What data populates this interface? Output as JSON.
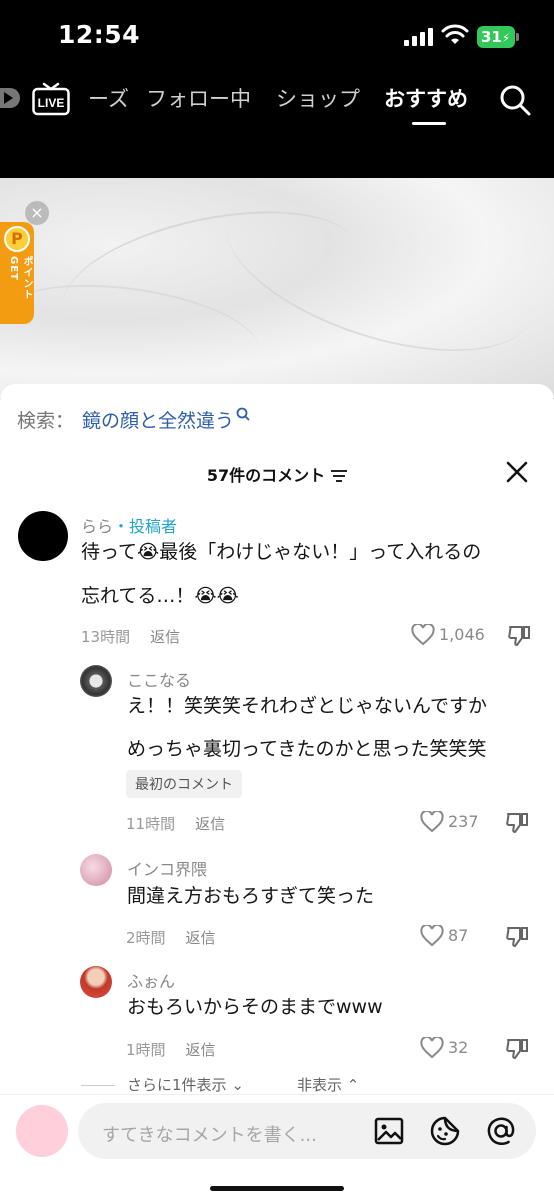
{
  "status": {
    "time": "12:54",
    "battery": "31"
  },
  "topnav": {
    "live_label": "LIVE",
    "tabs": [
      {
        "label": "ーズ",
        "active": false
      },
      {
        "label": "フォロー中",
        "active": false
      },
      {
        "label": "ショップ",
        "active": false
      },
      {
        "label": "おすすめ",
        "active": true
      }
    ]
  },
  "promo": {
    "label": "ポイントGET"
  },
  "sheet": {
    "search_prefix": "検索：",
    "search_query": "鏡の顔と全然違う",
    "title": "57件のコメント",
    "more_replies": "さらに1件表示",
    "hide": "非表示"
  },
  "comments": [
    {
      "user": "らら",
      "author_tag": "・投稿者",
      "lines": [
        "待って😭最後「わけじゃない！」って入れるの",
        "忘れてる…！😭😭"
      ],
      "time": "13時間",
      "reply": "返信",
      "likes": "1,046"
    }
  ],
  "replies": [
    {
      "user": "ここなる",
      "lines": [
        "え！！笑笑笑それわざとじゃないんですか",
        "めっちゃ裏切ってきたのかと思った笑笑笑"
      ],
      "badge": "最初のコメント",
      "time": "11時間",
      "reply": "返信",
      "likes": "237"
    },
    {
      "user": "インコ界隈",
      "lines": [
        "間違え方おもろすぎて笑った"
      ],
      "time": "2時間",
      "reply": "返信",
      "likes": "87"
    },
    {
      "user": "ふぉん",
      "lines": [
        "おもろいからそのままでwww"
      ],
      "time": "1時間",
      "reply": "返信",
      "likes": "32"
    }
  ],
  "input": {
    "placeholder": "すてきなコメントを書く..."
  },
  "colors": {
    "accent_author": "#20a4c8",
    "search_query": "#2f5fa8",
    "battery": "#34c759"
  }
}
